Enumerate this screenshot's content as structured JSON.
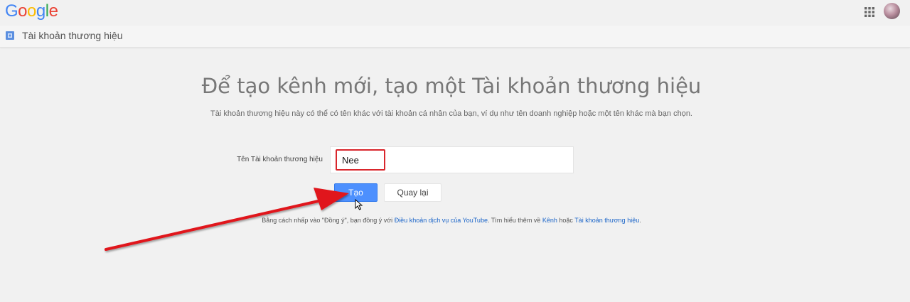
{
  "header": {
    "logo_letters": [
      "G",
      "o",
      "o",
      "g",
      "l",
      "e"
    ],
    "logo_colors": [
      "#4285f4",
      "#ea4335",
      "#fbbc05",
      "#4285f4",
      "#34a853",
      "#ea4335"
    ]
  },
  "subbar": {
    "title": "Tài khoản thương hiệu"
  },
  "main": {
    "headline": "Để tạo kênh mới, tạo một Tài khoản thương hiệu",
    "subline": "Tài khoản thương hiệu này có thể có tên khác với tài khoản cá nhân của bạn, ví dụ như tên doanh nghiệp hoặc một tên khác mà bạn chọn.",
    "field_label": "Tên Tài khoản thương hiệu",
    "input_value": "Nee",
    "create_label": "Tạo",
    "back_label": "Quay lại",
    "terms": {
      "prefix": "Bằng cách nhấp vào \"Đồng ý\", bạn đồng ý với ",
      "link_tos": "Điều khoản dịch vụ của YouTube",
      "middle": ". Tìm hiểu thêm về ",
      "link_channel": "Kênh",
      "connector": " hoặc ",
      "link_brand": "Tài khoản thương hiệu",
      "suffix": "."
    }
  },
  "colors": {
    "primary_button": "#4d90fe",
    "highlight_red": "#d9262c",
    "link": "#1a64c8"
  }
}
